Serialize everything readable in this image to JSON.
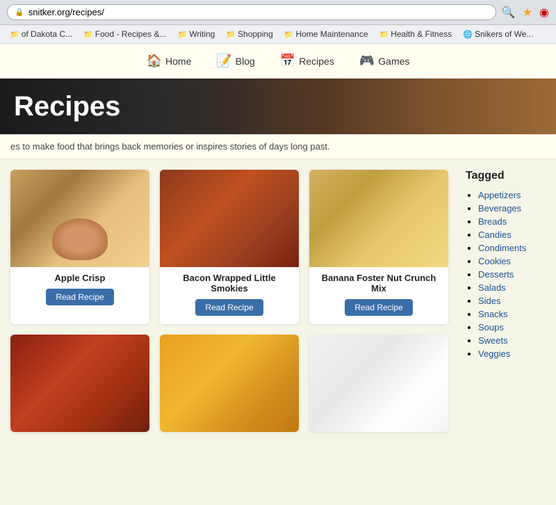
{
  "browser": {
    "url": "snitker.org/recipes/",
    "bookmarks": [
      {
        "label": "of Dakota C...",
        "icon": "📁"
      },
      {
        "label": "Food - Recipes &...",
        "icon": "📁"
      },
      {
        "label": "Writing",
        "icon": "📁"
      },
      {
        "label": "Shopping",
        "icon": "📁"
      },
      {
        "label": "Home Maintenance",
        "icon": "📁"
      },
      {
        "label": "Health & Fitness",
        "icon": "📁"
      },
      {
        "label": "Snikers of We...",
        "icon": "🌐"
      }
    ]
  },
  "nav": {
    "items": [
      {
        "label": "Home",
        "icon": "🏠"
      },
      {
        "label": "Blog",
        "icon": "📝"
      },
      {
        "label": "Recipes",
        "icon": "📅"
      },
      {
        "label": "Games",
        "icon": "🎮"
      }
    ]
  },
  "hero": {
    "title": "Recipes"
  },
  "description": {
    "text": "es to make food that brings back memories or inspires stories of days long past."
  },
  "recipes": [
    {
      "name": "Apple Crisp",
      "btn": "Read Recipe",
      "img": "apple-crisp"
    },
    {
      "name": "Bacon Wrapped Little Smokies",
      "btn": "Read Recipe",
      "img": "bacon-smokies"
    },
    {
      "name": "Banana Foster Nut Crunch Mix",
      "btn": "Read Recipe",
      "img": "banana-foster"
    },
    {
      "name": "",
      "btn": "",
      "img": "bbq"
    },
    {
      "name": "",
      "btn": "",
      "img": "cheesy"
    },
    {
      "name": "",
      "btn": "",
      "img": "bunny"
    }
  ],
  "sidebar": {
    "title": "Tagged",
    "tags": [
      "Appetizers",
      "Beverages",
      "Breads",
      "Candies",
      "Condiments",
      "Cookies",
      "Desserts",
      "Salads",
      "Sides",
      "Snacks",
      "Soups",
      "Sweets",
      "Veggies"
    ]
  }
}
